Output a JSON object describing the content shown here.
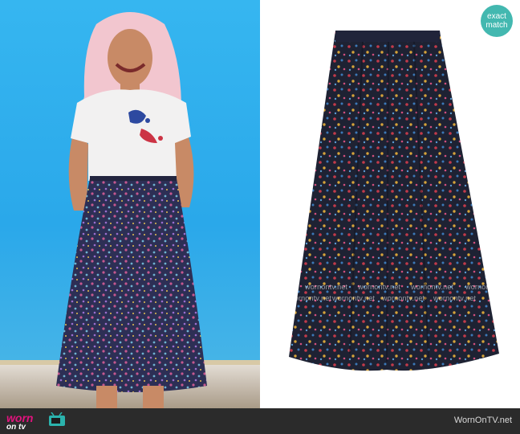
{
  "badge": {
    "line1": "exact",
    "line2": "match",
    "color": "#43b8b0"
  },
  "watermark": {
    "text": "wornontv.net"
  },
  "footer": {
    "logo_worn": "worn",
    "logo_ontv": "on tv",
    "site": "WornOnTV.net",
    "logo_color": "#e2137e",
    "background": "#2b2b2b"
  },
  "icons": {
    "tv": "tv-icon"
  },
  "colors": {
    "left_background": "#2aa8ea",
    "skirt_base": "#1e2233"
  }
}
